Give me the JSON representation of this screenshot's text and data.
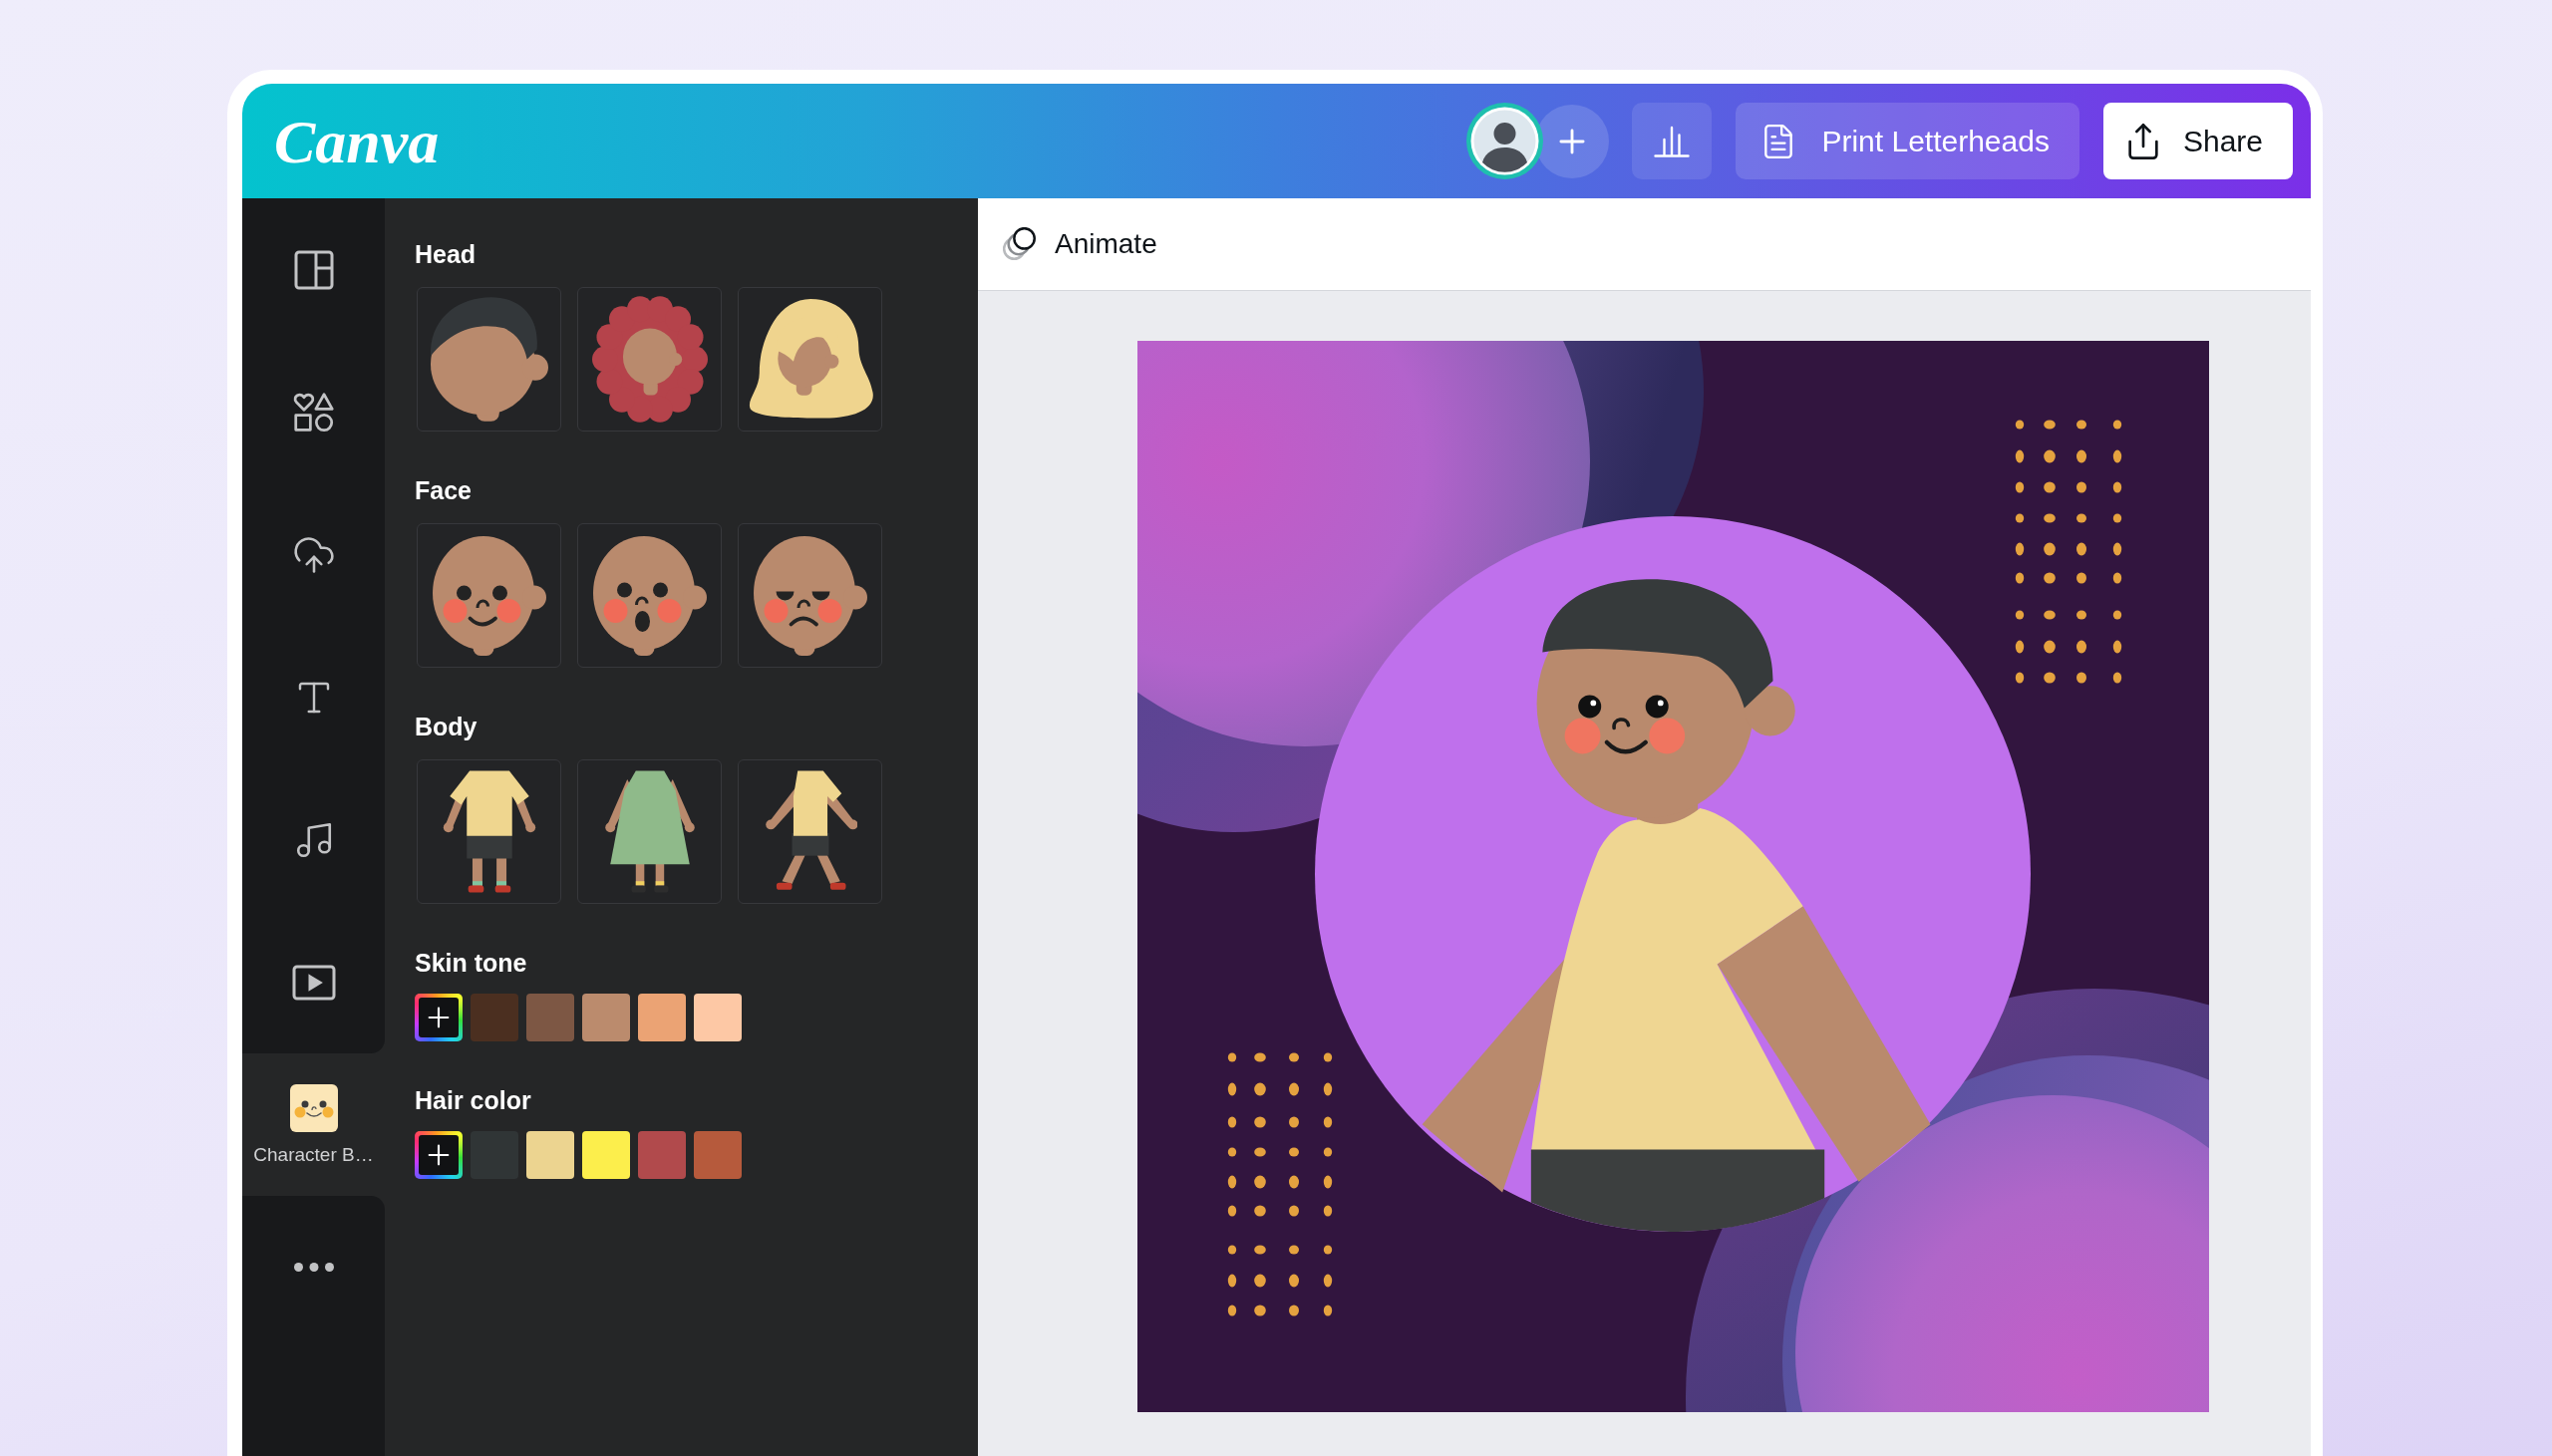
{
  "header": {
    "logo": "Canva",
    "print_button": "Print Letterheads",
    "share_button": "Share"
  },
  "sidebar": {
    "items": [
      {
        "selected": false
      },
      {
        "selected": false
      },
      {
        "selected": false
      },
      {
        "selected": false
      },
      {
        "selected": false
      },
      {
        "selected": false
      },
      {
        "label": "Character B…",
        "selected": true
      },
      {
        "selected": false
      }
    ]
  },
  "panel": {
    "sections": [
      {
        "title": "Head",
        "kind": "tiles"
      },
      {
        "title": "Face",
        "kind": "tiles"
      },
      {
        "title": "Body",
        "kind": "tiles"
      },
      {
        "title": "Skin tone",
        "kind": "swatches",
        "swatches": [
          {
            "color": "#4b2f20"
          },
          {
            "color": "#7d5744"
          },
          {
            "color": "#bb8b6d"
          },
          {
            "color": "#eba374"
          },
          {
            "color": "#fdc8a5"
          }
        ]
      },
      {
        "title": "Hair color",
        "kind": "swatches",
        "swatches": [
          {
            "color": "#303536"
          },
          {
            "color": "#ecd490"
          },
          {
            "color": "#fcee4c"
          },
          {
            "color": "#b14a4c"
          },
          {
            "color": "#b65a3c"
          }
        ]
      }
    ]
  },
  "editor": {
    "animate_button": "Animate"
  }
}
